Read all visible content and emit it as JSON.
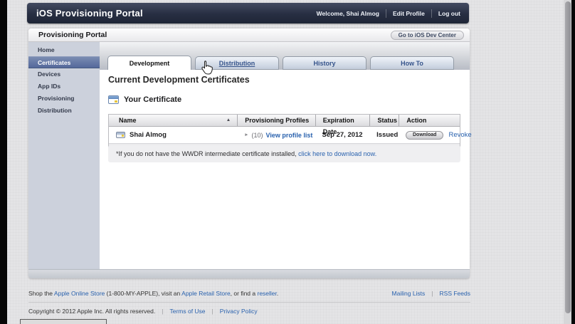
{
  "topbar": {
    "title": "iOS Provisioning Portal",
    "welcome": "Welcome, Shai Almog",
    "edit_profile": "Edit Profile",
    "log_out": "Log out"
  },
  "portal_header": {
    "title": "Provisioning Portal",
    "dev_center_button": "Go to iOS Dev Center"
  },
  "sidebar": {
    "items": [
      {
        "label": "Home",
        "selected": false
      },
      {
        "label": "Certificates",
        "selected": true
      },
      {
        "label": "Devices",
        "selected": false
      },
      {
        "label": "App IDs",
        "selected": false
      },
      {
        "label": "Provisioning",
        "selected": false
      },
      {
        "label": "Distribution",
        "selected": false
      }
    ]
  },
  "tabs": [
    {
      "label": "Development",
      "active": true
    },
    {
      "label": "Distribution",
      "active": false,
      "hovered": true
    },
    {
      "label": "History",
      "active": false
    },
    {
      "label": "How To",
      "active": false
    }
  ],
  "main": {
    "heading": "Current Development Certificates",
    "section_title": "Your Certificate",
    "table": {
      "columns": [
        "Name",
        "Provisioning Profiles",
        "Expiration Date",
        "Status",
        "Action"
      ],
      "row": {
        "name": "Shai Almog",
        "profiles_count": "(10)",
        "profiles_link": "View profile list",
        "expiration": "Sep 27, 2012",
        "status": "Issued",
        "download_label": "Download",
        "revoke_label": "Revoke"
      }
    },
    "note": {
      "text": "*If you do not have the WWDR intermediate certificate installed, ",
      "link": "click here to download now."
    }
  },
  "footer": {
    "shop_pre": "Shop the ",
    "shop_link1": "Apple Online Store",
    "shop_mid1": " (1-800-MY-APPLE), visit an ",
    "shop_link2": "Apple Retail Store",
    "shop_mid2": ", or find a ",
    "shop_link3": "reseller",
    "shop_end": ".",
    "mailing_lists": "Mailing Lists",
    "rss_feeds": "RSS Feeds",
    "separator": "|",
    "copyright": "Copyright © 2012 Apple Inc. All rights reserved.",
    "terms": "Terms of Use",
    "privacy": "Privacy Policy"
  },
  "icons": {
    "sort_ascending": "▲",
    "disclosure": "►"
  },
  "colors": {
    "navbar": "#272e42",
    "link_blue": "#2a62ae",
    "sidebar_selected": "#5e76a6",
    "page_background": "#e4e4e6",
    "tab_inactive_text": "#36548b"
  }
}
